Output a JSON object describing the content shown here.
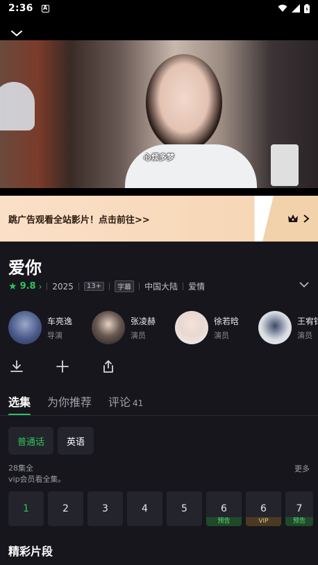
{
  "status": {
    "time": "2:36",
    "notification": "A"
  },
  "player": {
    "subtitle": "心烦多梦"
  },
  "ad": {
    "text": "跳广告观看全站影片！点击前往>>"
  },
  "show": {
    "title": "爱你",
    "score": "9.8",
    "year": "2025",
    "age": "13+",
    "subtitle_tag": "字幕",
    "region": "中国大陆",
    "genre": "爱情"
  },
  "cast": [
    {
      "name": "车亮逸",
      "role": "导演"
    },
    {
      "name": "张凌赫",
      "role": "演员"
    },
    {
      "name": "徐若晗",
      "role": "演员"
    },
    {
      "name": "王宥钧",
      "role": "演员"
    }
  ],
  "tabs": [
    {
      "label": "选集",
      "count": ""
    },
    {
      "label": "为你推荐",
      "count": ""
    },
    {
      "label": "评论",
      "count": "41"
    }
  ],
  "languages": [
    "普通话",
    "英语"
  ],
  "episode_info": {
    "count": "28集全",
    "vip": "vip会员看全集。",
    "more": "更多"
  },
  "episodes": [
    {
      "num": "1",
      "badge": ""
    },
    {
      "num": "2",
      "badge": ""
    },
    {
      "num": "3",
      "badge": ""
    },
    {
      "num": "4",
      "badge": ""
    },
    {
      "num": "5",
      "badge": ""
    },
    {
      "num": "6",
      "badge": "预告"
    },
    {
      "num": "6",
      "badge": "VIP"
    },
    {
      "num": "7",
      "badge": "预告"
    }
  ],
  "clips_title": "精彩片段",
  "colors": {
    "accent": "#2fc35a",
    "background": "#16161c",
    "ad_bg": "#fbe0c8"
  }
}
